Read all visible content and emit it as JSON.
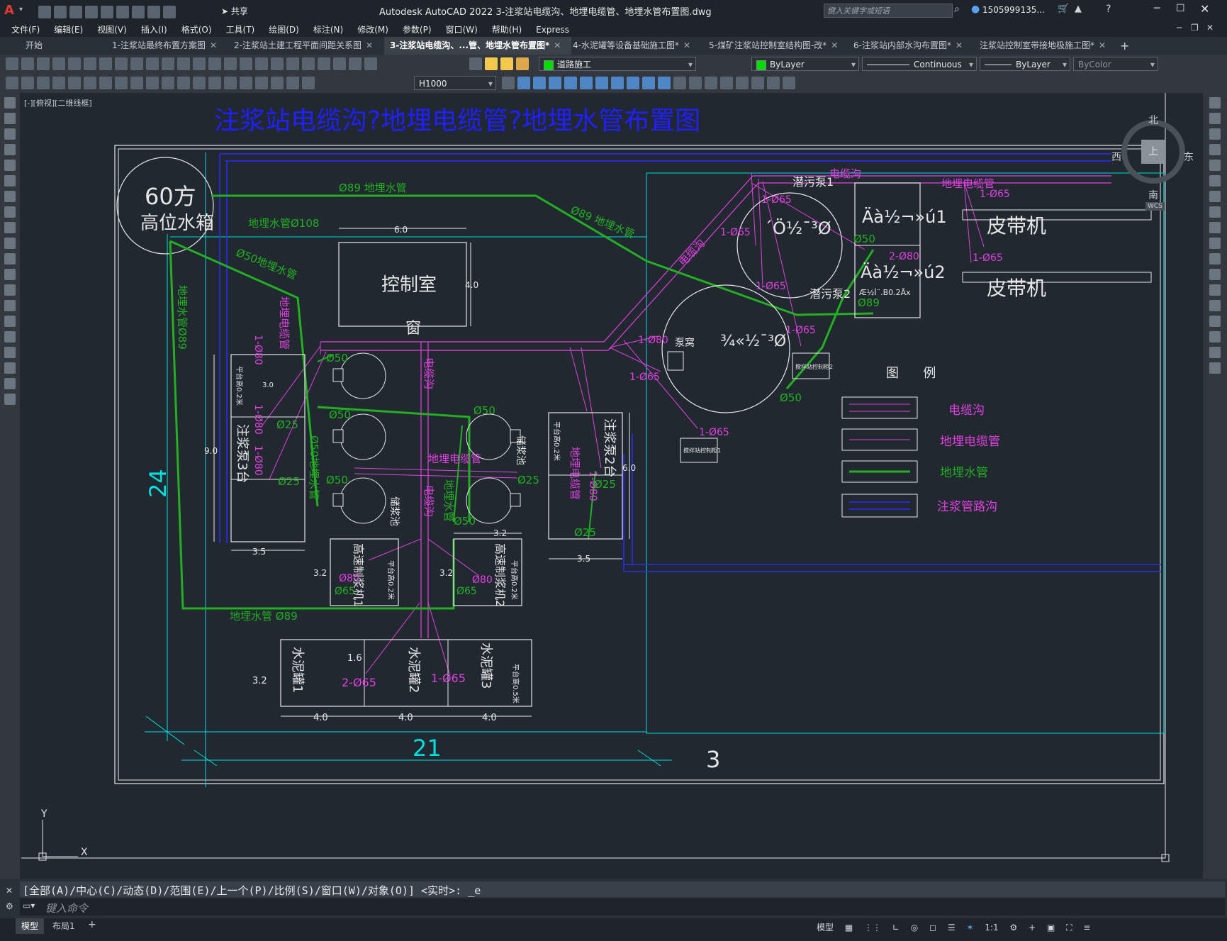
{
  "app": {
    "title": "Autodesk AutoCAD 2022    3-注浆站电缆沟、地埋电缆管、地埋水管布置图.dwg",
    "search_placeholder": "键入关键字或短语",
    "user": "1505999135...",
    "share": "共享",
    "express": "Express"
  },
  "menu": [
    "文件(F)",
    "编辑(E)",
    "视图(V)",
    "插入(I)",
    "格式(O)",
    "工具(T)",
    "绘图(D)",
    "标注(N)",
    "修改(M)",
    "参数(P)",
    "窗口(W)",
    "帮助(H)",
    "Express"
  ],
  "tabs": [
    {
      "label": "开始"
    },
    {
      "label": "1-注浆站最终布置方案图"
    },
    {
      "label": "2-注浆站土建工程平面间距关系图"
    },
    {
      "label": "3-注浆站电缆沟、...管、地埋水管布置图*"
    },
    {
      "label": "4-水泥罐等设备基础施工图*"
    },
    {
      "label": "5-煤矿注浆站控制室结构图-改*"
    },
    {
      "label": "6-注浆站内部水沟布置图*"
    },
    {
      "label": "注浆站控制室带接地极施工图*"
    }
  ],
  "toolbar": {
    "layer": "道路施工",
    "layer_color": "#00e000",
    "color": "ByLayer",
    "color_swatch": "#00e000",
    "linetype": "Continuous",
    "lineweight": "ByLayer",
    "plotstyle": "ByColor",
    "dimstyle": "H1000"
  },
  "viewport_label": "[-][俯视][二维线框]",
  "viewcube": {
    "north": "北",
    "south": "南",
    "east": "东",
    "west": "西",
    "top": "上",
    "wcs": "WCS"
  },
  "drawing": {
    "title": "注浆站电缆沟?地埋电缆管?地埋水管布置图",
    "tank_line1": "60方",
    "tank_line2": "高位水箱",
    "control_room": "控制室",
    "window": "窗",
    "water_pipe_89_top": "Ø89 地埋水管",
    "water_pipe_89_diag": "Ø89 地埋水管",
    "water_pipe_108": "地埋水管Ø108",
    "water_pipe_50_diag": "Ø50地埋水管",
    "water_pipe_89_vert": "地埋水管Ø89",
    "water_pipe_89_bottom": "地埋水管 Ø89",
    "cable_pipe_left": "地埋电缆管",
    "cable_trench_center": "电缆沟",
    "cable_trench_center2": "电缆沟",
    "cable_pipe_mid": "地埋电缆管",
    "water_pipe_mid": "地埋水管",
    "cable_trench_top": "电缆沟",
    "cable_trench_diag": "电缆沟",
    "cable_pipe_top_right": "地埋电缆管",
    "pump1": "潜污泵1",
    "pump2": "潜污泵2",
    "belt1": "皮带机",
    "belt2": "皮带机",
    "pump3": "注浆泵3台",
    "pump2_tai": "注浆泵2台",
    "mixer1": "高速制浆机1",
    "mixer2": "高速制浆机2",
    "cement1": "水泥罐1",
    "cement2": "水泥罐2",
    "cement3": "水泥罐3",
    "storage_left": "储浆池",
    "storage_right": "储浆池",
    "pump_pit": "泵窝",
    "garbled1": "ˊÖ½¯³Ø",
    "garbled2": "Äà½¬»ú1",
    "garbled3": "Äà½¬»ú2",
    "garbled4": "¾«½¯³Ø",
    "garbled5": "Æ½Ì¨.B0.2Ãx",
    "plat1": "平台高0.2米",
    "plat2": "平台高0.2米",
    "plat3": "平台高0.2米",
    "plat4": "平台高0.2米",
    "plat5": "平台高0.5米",
    "dim_24": "24",
    "dim_21": "21",
    "dim_3": "3",
    "dim_6": "6.0",
    "dim_4": "4.0",
    "dim_35a": "3.5",
    "dim_35b": "3.5",
    "dim_32a": "3.2",
    "dim_32b": "3.2",
    "dim_32c": "3.2",
    "dim_32d": "3.2",
    "dim_9": "9.0",
    "dim_30": "3.0",
    "dim_6b": "6.0",
    "dim_4a": "4.0",
    "dim_4b": "4.0",
    "dim_4c": "4.0",
    "dim_16": "1.6",
    "d65_1": "1-Ø65",
    "d65_2": "1-Ø65",
    "d65_3": "1-Ø65",
    "d65_4": "1-Ø65",
    "d65_5": "1-Ø65",
    "d65_6": "1-Ø65",
    "d65_7": "1-Ø65",
    "d65_8": "2-Ø65",
    "d65_9": "1-Ø65",
    "d80_1": "1-Ø80",
    "d80_2": "2-Ø80",
    "d80_3": "1-Ø80",
    "d80_4": "1-Ø80",
    "d80_5": "1-Ø80",
    "d80_6": "1-Ø80",
    "d50_1": "Ø50",
    "d50_2": "Ø50",
    "d50_3": "Ø50",
    "d50_4": "Ø50",
    "d50_5": "Ø50",
    "d50_6": "Ø50",
    "d50_7": "Ø50",
    "d25_1": "Ø25",
    "d25_2": "Ø25",
    "d25_3": "Ø25",
    "d25_4": "Ø25",
    "d25_5": "Ø25",
    "d89_r": "Ø89",
    "d65_g1": "Ø65",
    "d65_g2": "Ø65",
    "d80_g1": "Ø80",
    "d80_g2": "Ø80",
    "box_small1": "搅拌站控制柜1",
    "box_small2": "搅拌站控制柜2"
  },
  "legend": {
    "title": "图      例",
    "items": [
      {
        "label": "电缆沟",
        "color": "#e040e0"
      },
      {
        "label": "地埋电缆管",
        "color": "#e040e0"
      },
      {
        "label": "地埋水管",
        "color": "#22b022"
      },
      {
        "label": "注浆管路沟",
        "color": "#2a2aff"
      }
    ]
  },
  "command": {
    "history": "[全部(A)/中心(C)/动态(D)/范围(E)/上一个(P)/比例(S)/窗口(W)/对象(O)] <实时>: _e",
    "placeholder": "键入命令"
  },
  "layout_tabs": [
    "模型",
    "布局1"
  ],
  "status": {
    "model": "模型",
    "scale": "1:1"
  },
  "ucs": {
    "x": "X",
    "y": "Y"
  }
}
